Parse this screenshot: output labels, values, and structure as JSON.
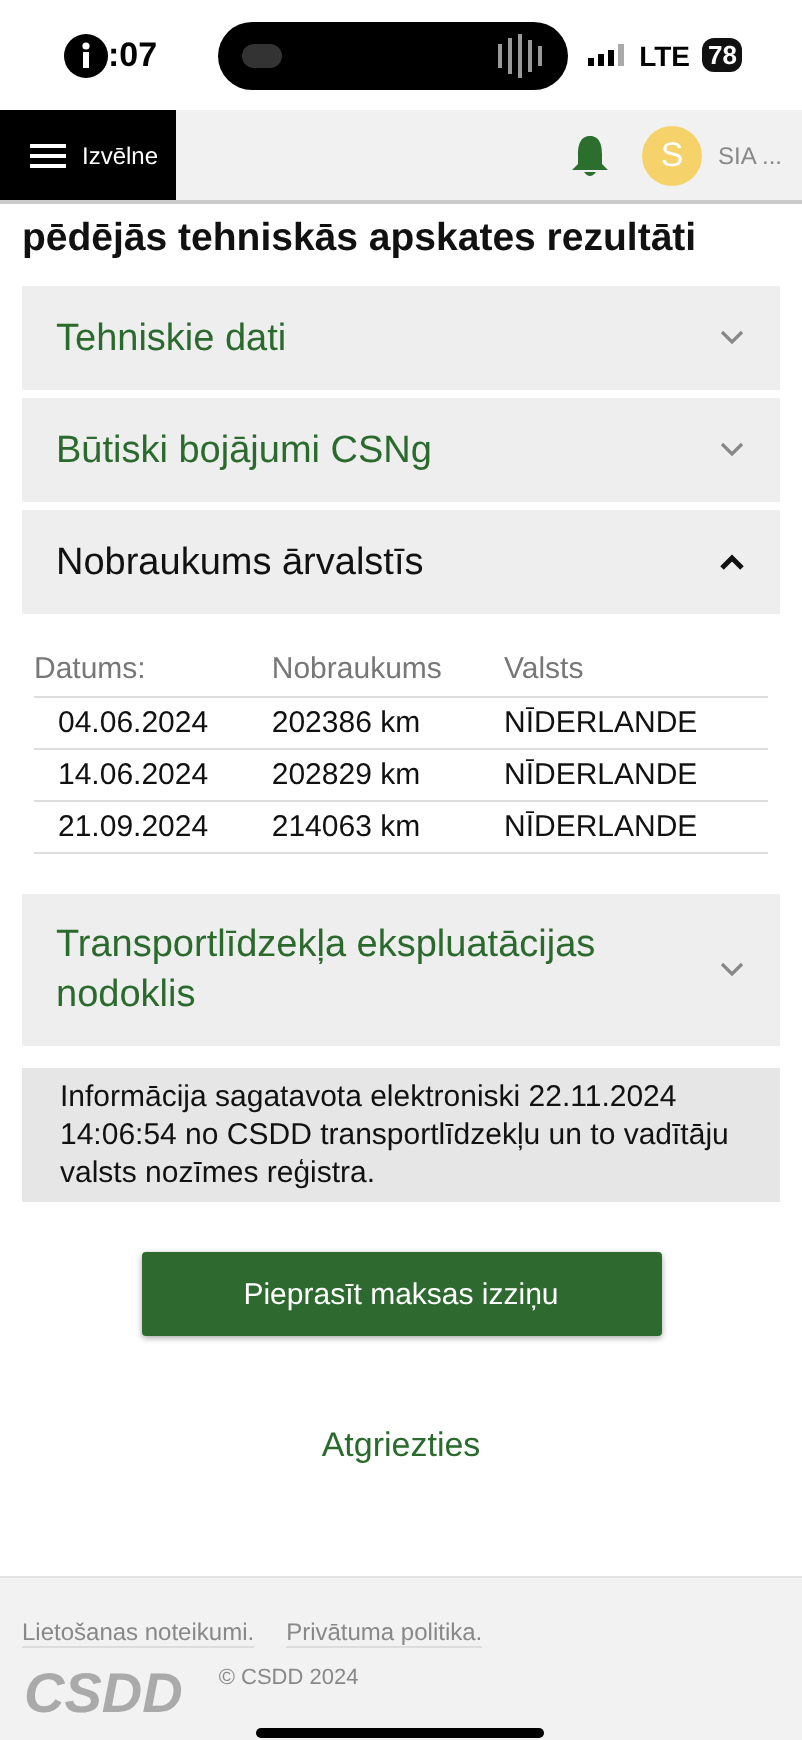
{
  "status_bar": {
    "time": ":07",
    "network": "LTE",
    "battery": "78"
  },
  "header": {
    "menu_label": "Izvēlne",
    "avatar_initial": "S",
    "account": "SIA ..."
  },
  "heading": "pēdējās tehniskās apskates rezultāti",
  "sections": [
    {
      "title": "Tehniskie dati",
      "expanded": false
    },
    {
      "title": "Būtiski bojājumi CSNg",
      "expanded": false
    },
    {
      "title": "Nobraukums ārvalstīs",
      "expanded": true,
      "table": {
        "columns": [
          "Datums:",
          "Nobraukums",
          "Valsts"
        ],
        "rows": [
          [
            "04.06.2024",
            "202386 km",
            "NĪDERLANDE"
          ],
          [
            "14.06.2024",
            "202829 km",
            "NĪDERLANDE"
          ],
          [
            "21.09.2024",
            "214063 km",
            "NĪDERLANDE"
          ]
        ]
      }
    },
    {
      "title": "Transportlīdzekļa ekspluatācijas nodoklis",
      "expanded": false
    }
  ],
  "info": "Informācija sagatavota elektroniski 22.11.2024 14:06:54 no CSDD transportlīdzekļu un to vadītāju valsts nozīmes reģistra.",
  "action_button": "Pieprasīt maksas izziņu",
  "back_link": "Atgriezties",
  "footer": {
    "links": [
      "Lietošanas noteikumi.",
      "Privātuma politika."
    ],
    "logo": "CSDD",
    "copyright": "© CSDD 2024"
  }
}
